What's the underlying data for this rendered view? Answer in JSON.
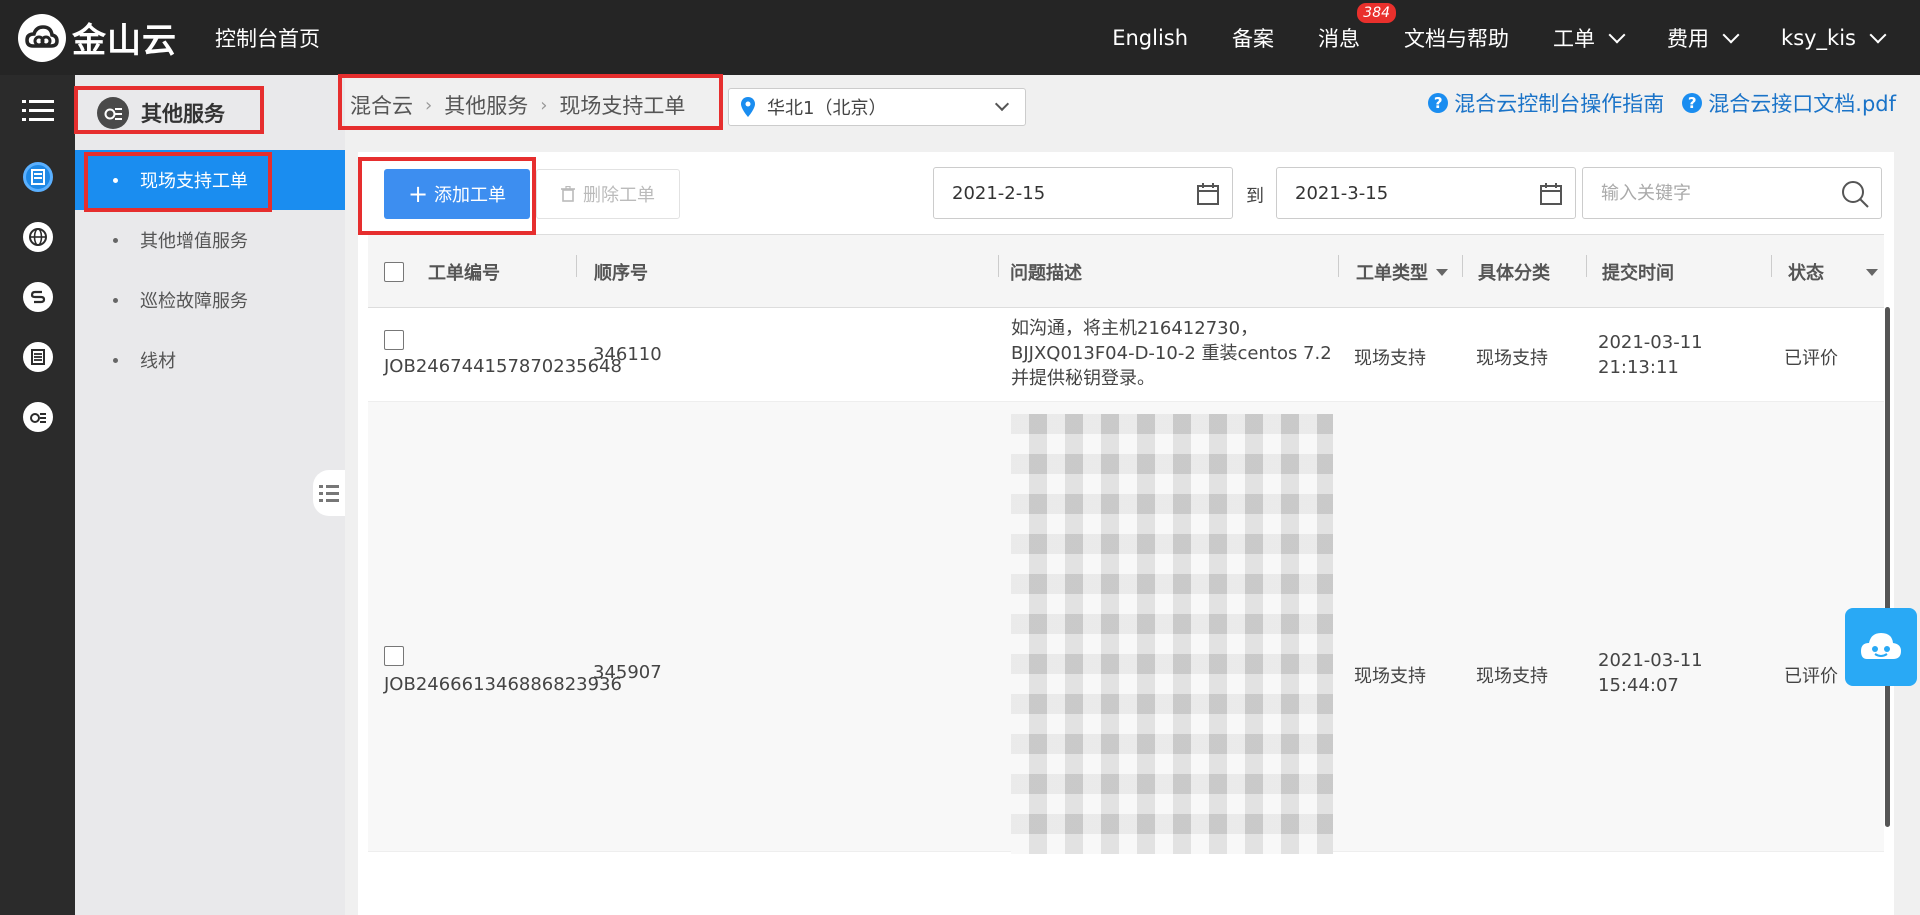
{
  "header": {
    "logo_text": "金山云",
    "console_home": "控制台首页",
    "nav": [
      {
        "label": "English"
      },
      {
        "label": "备案"
      },
      {
        "label": "消息",
        "badge": "384"
      },
      {
        "label": "文档与帮助"
      },
      {
        "label": "工单",
        "dropdown": true
      },
      {
        "label": "费用",
        "dropdown": true
      },
      {
        "label": "ksy_kis",
        "dropdown": true
      }
    ]
  },
  "rail": {
    "items": [
      "menu-icon",
      "server-list-icon",
      "globe-icon",
      "switch-icon",
      "document-list-icon",
      "service-coin-icon"
    ]
  },
  "sidebar": {
    "title": "其他服务",
    "items": [
      {
        "label": "现场支持工单",
        "active": true
      },
      {
        "label": "其他增值服务"
      },
      {
        "label": "巡检故障服务"
      },
      {
        "label": "线材"
      }
    ]
  },
  "breadcrumb": [
    "混合云",
    "其他服务",
    "现场支持工单"
  ],
  "region": {
    "value": "华北1（北京）"
  },
  "help": {
    "guide": "混合云控制台操作指南",
    "api_doc": "混合云接口文档.pdf"
  },
  "toolbar": {
    "add_label": "添加工单",
    "delete_label": "删除工单",
    "date_from": "2021-2-15",
    "date_to_label": "到",
    "date_to": "2021-3-15",
    "search_placeholder": "输入关键字"
  },
  "table": {
    "columns": [
      "工单编号",
      "顺序号",
      "问题描述",
      "工单类型",
      "具体分类",
      "提交时间",
      "状态"
    ],
    "rows": [
      {
        "job_id": "JOB246744157870235648",
        "seq": "346110",
        "desc_lines": [
          "如沟通，将主机216412730，",
          "BJJXQ013F04-D-10-2 重装centos 7.2",
          "并提供秘钥登录。"
        ],
        "type": "现场支持",
        "category": "现场支持",
        "time_date": "2021-03-11",
        "time_clock": "21:13:11",
        "status": "已评价"
      },
      {
        "job_id": "JOB246661346886823936",
        "seq": "345907",
        "desc_lines": [],
        "type": "现场支持",
        "category": "现场支持",
        "time_date": "2021-03-11",
        "time_clock": "15:44:07",
        "status": "已评价"
      }
    ]
  },
  "colors": {
    "topbar": "#252525",
    "accent": "#1a8df0",
    "primary_button": "#3d8ef0",
    "annotation": "#e62e2e",
    "badge": "#e9302c"
  }
}
